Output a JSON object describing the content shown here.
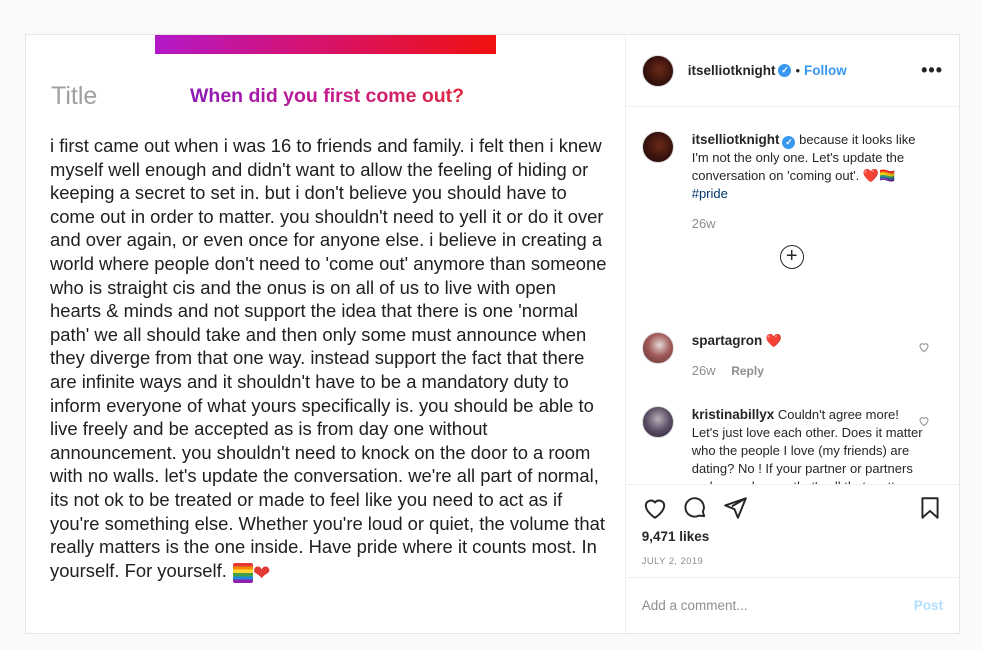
{
  "post_image": {
    "title_label": "Title",
    "question": "When did you first come out?",
    "body_text": "i first came out when i was 16 to friends and family. i felt then i knew myself well enough and didn't want to allow the feeling of hiding or keeping a secret to set in. but i don't believe you should have to come out in order to matter. you shouldn't need to yell it or do it over and over again, or even once for anyone else. i believe in creating a world where people don't need to 'come out' anymore than someone who is straight cis and the onus is on all of us to live with open hearts & minds and not support the idea that there is one 'normal path' we all should take and then only some must announce when they diverge from that one way. instead support the fact that there are infinite ways and it shouldn't have to be a mandatory duty to inform everyone of what yours specifically is. you should be able to live freely and be accepted as is from day one without announcement. you shouldn't need to knock on the door to a room with no walls. let's update the conversation. we're all part of normal, its not ok to be treated or made to feel like you need to act as if you're something else. Whether you're loud or quiet, the volume that really matters is the one inside. Have pride where it counts most. In yourself. For yourself.",
    "heart_emoji": "❤"
  },
  "header": {
    "username": "itselliotknight",
    "verified_mark": "✓",
    "separator": "•",
    "follow_label": "Follow",
    "more_label": "•••"
  },
  "caption": {
    "username": "itselliotknight",
    "text": "because it looks like I'm not the only one. Let's update the conversation on 'coming out'. ❤️🏳️‍🌈",
    "hashtag": "#pride",
    "time": "26w",
    "load_more": "+"
  },
  "comments": [
    {
      "username": "spartagron",
      "text": "❤️",
      "time": "26w",
      "reply_label": "Reply"
    },
    {
      "username": "kristinabillyx",
      "text": "Couldn't agree more! Let's just love each other. Does it matter who the people I love (my friends) are dating? No ! If your partner or partners make you happy, that's all that matters."
    }
  ],
  "stats": {
    "likes": "9,471 likes",
    "date": "JULY 2, 2019"
  },
  "add_comment": {
    "placeholder": "Add a comment...",
    "post_label": "Post"
  },
  "colors": {
    "accent": "#3897f0",
    "muted": "#8e8e8e",
    "post_button_disabled": "#b2dffc"
  }
}
